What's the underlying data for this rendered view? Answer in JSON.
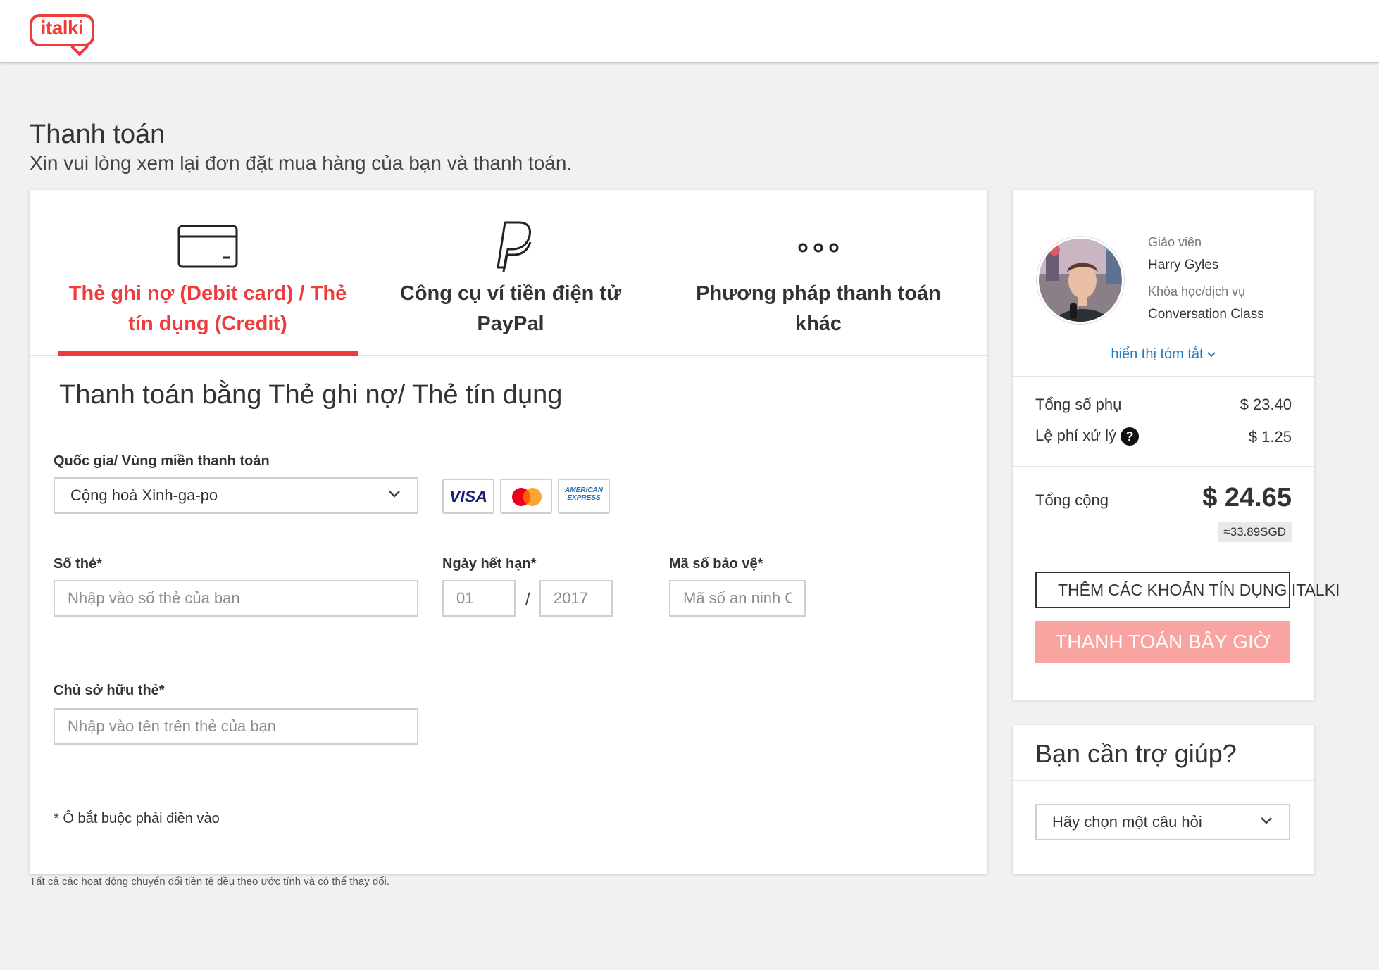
{
  "header": {
    "logo_text": "italki"
  },
  "page": {
    "title": "Thanh toán",
    "subtitle": "Xin vui lòng xem lại đơn đặt mua hàng của bạn và thanh toán."
  },
  "payment_tabs": [
    {
      "label": "Thẻ ghi nợ (Debit card) / Thẻ tín dụng (Credit)",
      "icon": "credit-card-icon",
      "active": true
    },
    {
      "label": "Công cụ ví tiền điện tử PayPal",
      "icon": "paypal-icon",
      "active": false
    },
    {
      "label": "Phương pháp thanh toán khác",
      "icon": "more-icon",
      "active": false
    }
  ],
  "form": {
    "section_title": "Thanh toán bằng Thẻ ghi nợ/ Thẻ tín dụng",
    "country_label": "Quốc gia/ Vùng miền thanh toán",
    "country_value": "Cộng hoà Xinh-ga-po",
    "card_brands": [
      "VISA",
      "mastercard",
      "AMERICAN EXPRESS"
    ],
    "card_number_label": "Số thẻ*",
    "card_number_placeholder": "Nhập vào số thẻ của bạn",
    "expiry_label": "Ngày hết hạn*",
    "expiry_month": "01",
    "expiry_separator": "/",
    "expiry_year": "2017",
    "cvv_label": "Mã số bảo vệ*",
    "cvv_placeholder": "Mã số an ninh CVV",
    "holder_label": "Chủ sở hữu thẻ*",
    "holder_placeholder": "Nhập vào tên trên thẻ của bạn",
    "required_note": "* Ô bắt buộc phải điền vào"
  },
  "disclaimer": "Tất cả các hoạt động chuyển đổi tiền tệ đều theo ước tính và có thể thay đổi.",
  "order_summary": {
    "teacher_label": "Giáo viên",
    "teacher_name": "Harry Gyles",
    "course_label": "Khóa học/dịch vụ",
    "course_name": "Conversation Class",
    "show_summary_link": "hiển thị tóm tắt",
    "subtotal_label": "Tổng số phụ",
    "subtotal_value": "$ 23.40",
    "fee_label": "Lệ phí xử lý",
    "fee_help": "?",
    "fee_value": "$ 1.25",
    "total_label": "Tổng cộng",
    "total_value": "$ 24.65",
    "total_sgd": "≈33.89SGD",
    "add_credits_button": "THÊM CÁC KHOẢN TÍN DỤNG ITALKI",
    "pay_now_button": "THANH TOÁN BÂY GIỜ"
  },
  "help": {
    "title": "Bạn cần trợ giúp?",
    "select_value": "Hãy chọn một câu hỏi"
  },
  "colors": {
    "brand": "#ef3b3b",
    "pay_button": "#f8a4a0",
    "link": "#1f7ac4"
  }
}
